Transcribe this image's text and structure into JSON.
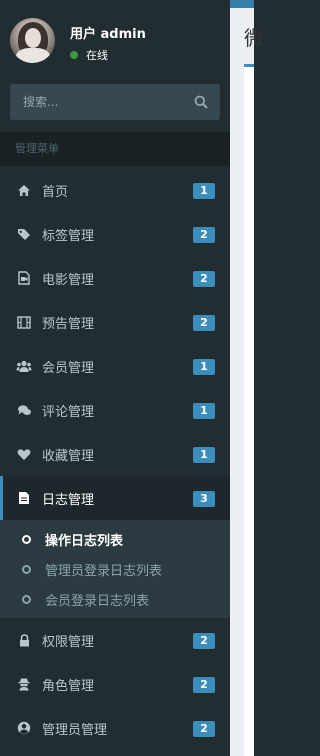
{
  "user": {
    "name": "用户 admin",
    "status": "在线"
  },
  "search": {
    "placeholder": "搜索..."
  },
  "header": "管理菜单",
  "menu": [
    {
      "label": "首页",
      "badge": "1",
      "icon": "home-icon"
    },
    {
      "label": "标签管理",
      "badge": "2",
      "icon": "tags-icon"
    },
    {
      "label": "电影管理",
      "badge": "2",
      "icon": "video-file-icon"
    },
    {
      "label": "预告管理",
      "badge": "2",
      "icon": "film-icon"
    },
    {
      "label": "会员管理",
      "badge": "1",
      "icon": "users-icon"
    },
    {
      "label": "评论管理",
      "badge": "1",
      "icon": "comments-icon"
    },
    {
      "label": "收藏管理",
      "badge": "1",
      "icon": "heart-icon"
    },
    {
      "label": "日志管理",
      "badge": "3",
      "icon": "file-text-icon"
    },
    {
      "label": "权限管理",
      "badge": "2",
      "icon": "lock-icon"
    },
    {
      "label": "角色管理",
      "badge": "2",
      "icon": "user-secret-icon"
    },
    {
      "label": "管理员管理",
      "badge": "2",
      "icon": "user-circle-icon"
    }
  ],
  "log_submenu": [
    {
      "label": "操作日志列表"
    },
    {
      "label": "管理员登录日志列表"
    },
    {
      "label": "会员登录日志列表"
    }
  ],
  "content": {
    "title_fragment": "微"
  },
  "colors": {
    "sidebar_bg": "#222d32",
    "accent": "#3c8dbc",
    "online": "#3c9a3c"
  }
}
